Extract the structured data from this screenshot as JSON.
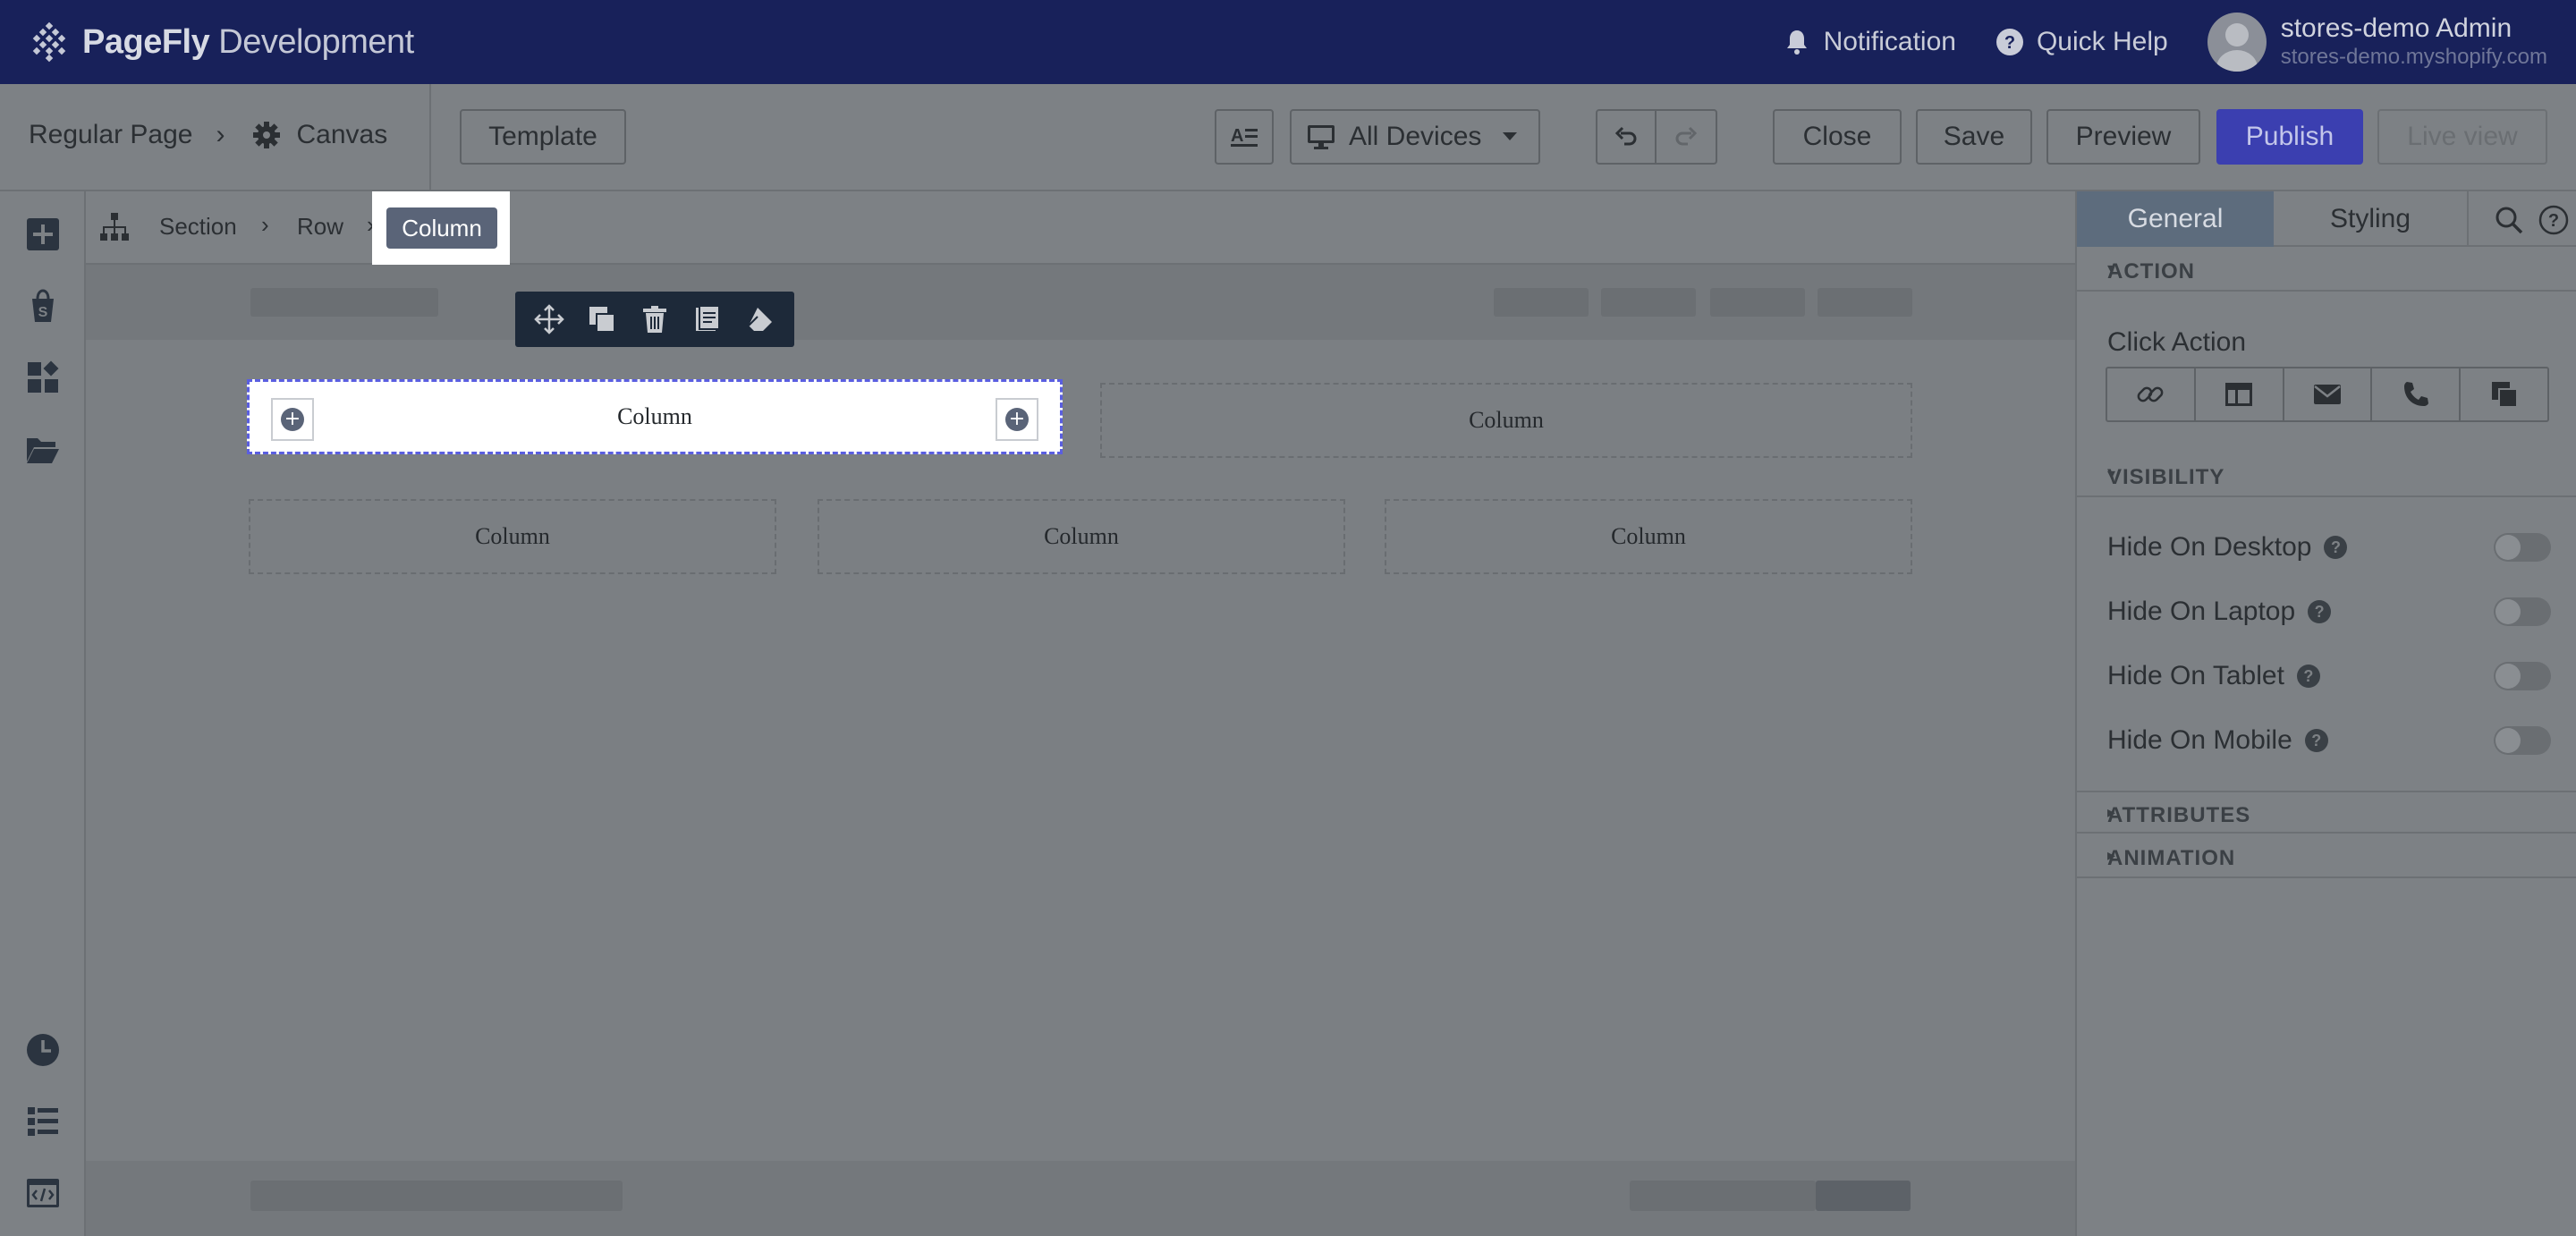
{
  "app": {
    "brand_bold": "PageFly",
    "brand_rest": " Development"
  },
  "topbar": {
    "notification_label": "Notification",
    "quick_help_label": "Quick Help",
    "user_name": "stores-demo Admin",
    "user_store": "stores-demo.myshopify.com"
  },
  "toolbar": {
    "page_type": "Regular Page",
    "canvas_label": "Canvas",
    "template_label": "Template",
    "device_label": "All Devices",
    "close_label": "Close",
    "save_label": "Save",
    "preview_label": "Preview",
    "publish_label": "Publish",
    "live_view_label": "Live view"
  },
  "breadcrumb": {
    "items": [
      "Section",
      "Row",
      "Column"
    ]
  },
  "canvas": {
    "row1": [
      "Column",
      "Column"
    ],
    "row2": [
      "Column",
      "Column",
      "Column"
    ]
  },
  "panel": {
    "tabs": [
      "General",
      "Styling"
    ],
    "action_header": "ACTION",
    "click_action_label": "Click Action",
    "visibility_header": "VISIBILITY",
    "visibility_rows": [
      {
        "label": "Hide On Desktop",
        "on": false
      },
      {
        "label": "Hide On Laptop",
        "on": false
      },
      {
        "label": "Hide On Tablet",
        "on": false
      },
      {
        "label": "Hide On Mobile",
        "on": false
      }
    ],
    "attributes_header": "ATTRIBUTES",
    "animation_header": "ANIMATION"
  },
  "colors": {
    "topbar": "#18215a",
    "publish": "#3b3fb0",
    "selection_outline": "#5a5ee0"
  }
}
